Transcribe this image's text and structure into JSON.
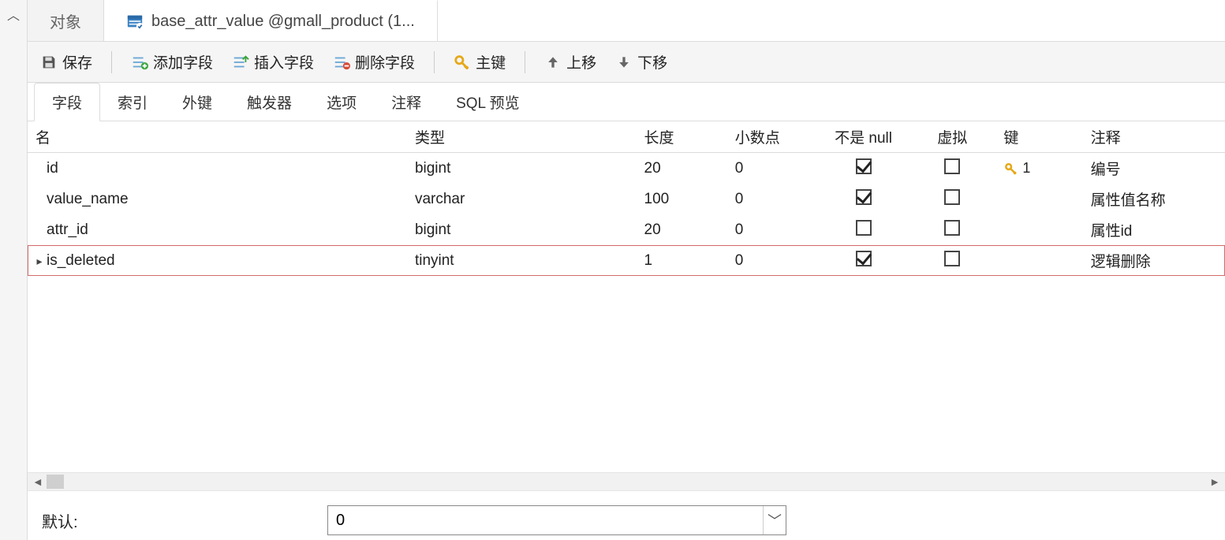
{
  "tabs": {
    "object": "对象",
    "active": "base_attr_value @gmall_product (1..."
  },
  "toolbar": {
    "save": "保存",
    "add_field": "添加字段",
    "insert_field": "插入字段",
    "delete_field": "删除字段",
    "primary_key": "主键",
    "move_up": "上移",
    "move_down": "下移"
  },
  "subtabs": {
    "fields": "字段",
    "indexes": "索引",
    "foreign_keys": "外键",
    "triggers": "触发器",
    "options": "选项",
    "comments": "注释",
    "sql_preview": "SQL 预览"
  },
  "columns": {
    "name": "名",
    "type": "类型",
    "length": "长度",
    "decimals": "小数点",
    "not_null": "不是 null",
    "virtual": "虚拟",
    "key": "键",
    "comment": "注释"
  },
  "rows": [
    {
      "name": "id",
      "type": "bigint",
      "length": "20",
      "decimals": "0",
      "not_null": true,
      "virtual": false,
      "key": "1",
      "comment": "编号",
      "selected": false
    },
    {
      "name": "value_name",
      "type": "varchar",
      "length": "100",
      "decimals": "0",
      "not_null": true,
      "virtual": false,
      "key": "",
      "comment": "属性值名称",
      "selected": false
    },
    {
      "name": "attr_id",
      "type": "bigint",
      "length": "20",
      "decimals": "0",
      "not_null": false,
      "virtual": false,
      "key": "",
      "comment": "属性id",
      "selected": false
    },
    {
      "name": "is_deleted",
      "type": "tinyint",
      "length": "1",
      "decimals": "0",
      "not_null": true,
      "virtual": false,
      "key": "",
      "comment": "逻辑删除",
      "selected": true
    }
  ],
  "bottom": {
    "default_label": "默认:",
    "default_value": "0"
  },
  "colwidths": {
    "name": 480,
    "type": 290,
    "length": 115,
    "decimals": 115,
    "not_null": 115,
    "virtual": 110,
    "key": 110,
    "comment": 180
  },
  "icons": {
    "table": "table-icon",
    "save": "save-icon",
    "add": "plus-icon",
    "insert": "insert-icon",
    "delete": "minus-icon",
    "key": "key-icon",
    "up": "arrow-up-icon",
    "down": "arrow-down-icon"
  }
}
